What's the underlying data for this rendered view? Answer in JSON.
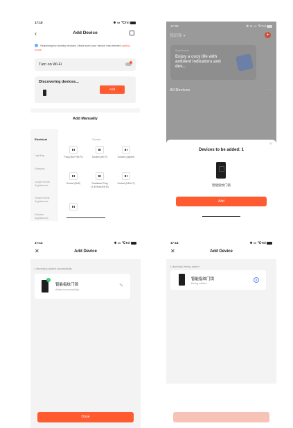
{
  "status": {
    "p1_time": "17:15",
    "p1_icons": "✱ ▭ ℃Tsl",
    "p2_time": "17:08",
    "p2_icons": "✱ ⊙ ▭ ℃Tsl",
    "p3_time": "17:14",
    "p3_icons": "✱ ▭ ℃Tsl",
    "p4_time": "17:14",
    "p4_icons": "✱ ▭ ℃Tsl"
  },
  "add_device": {
    "back_icon": "‹",
    "title": "Add Device",
    "tip_text": "Searching for nearby devices. Make sure your device has entered ",
    "tip_link": "pairing mode.",
    "wifi_label": "Turn on Wi-Fi",
    "discovering_label": "Discovering devices...",
    "add_label": "Add",
    "manual_title": "Add Manually",
    "categories": [
      "Electrical",
      "Lighting",
      "Sensors",
      "Large Home Appliances",
      "Small Home Appliances",
      "Kitchen Appliances"
    ],
    "column_headers": [
      "Socket"
    ],
    "devices": [
      {
        "name": "Plug (BLE+Wi-Fi)"
      },
      {
        "name": "Socket (Wi-Fi)"
      },
      {
        "name": "Socket (Zigbee)"
      },
      {
        "name": "Socket (BLE)"
      },
      {
        "name": "Dualband Plug (2.4GHz&5GHz)"
      },
      {
        "name": "Socket (NB-IoT)"
      },
      {
        "name": ""
      }
    ]
  },
  "home": {
    "home_name": "我的家 ▾",
    "plus_label": "+",
    "banner_small": "Smart Home",
    "banner_big": "Enjoy a cozy life with ambient indicators and dev...",
    "all_devices": "All Devices",
    "more": "···",
    "sheet_close": "×",
    "sheet_title": "Devices to be added: 1",
    "device_name": "智能指纹门锁",
    "add_button": "Add"
  },
  "result": {
    "close_icon": "✕",
    "title": "Add Device",
    "message": "1 device(s) added successfully",
    "device_name": "智能指纹门锁",
    "device_status": "Added successfully",
    "check": "✓",
    "edit_icon": "✎",
    "done_label": "Done"
  },
  "adding": {
    "close_icon": "✕",
    "title": "Add Device",
    "message": "1 device(s) being added",
    "device_name": "智能指纹门锁",
    "device_status": "Being added",
    "done_label": ""
  },
  "colors": {
    "accent": "#ff5a30",
    "success": "#33c26a",
    "progress": "#5b8def"
  }
}
